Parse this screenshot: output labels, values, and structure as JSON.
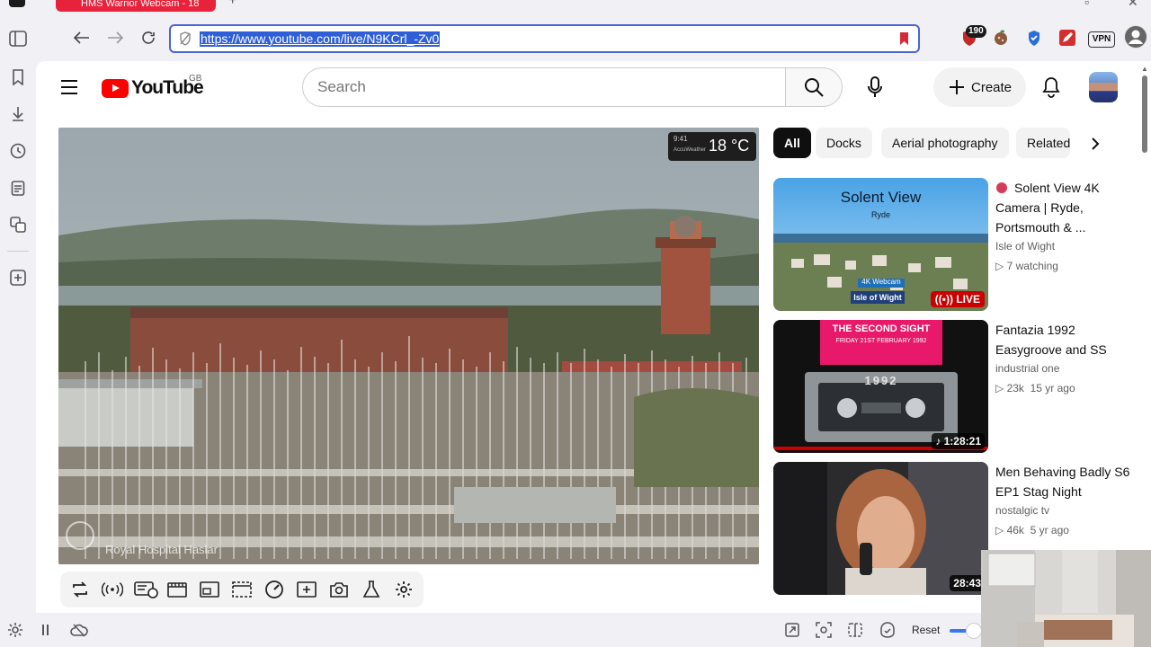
{
  "browser": {
    "tab_title": "HMS Warrior Webcam - 18",
    "url": "https://www.youtube.com/live/N9KCrl_-Zv0",
    "extension_badge": "190",
    "vpn_label": "VPN"
  },
  "youtube": {
    "logo_text": "YouTube",
    "region": "GB",
    "search_placeholder": "Search",
    "create_label": "Create"
  },
  "video": {
    "weather_time": "9:41",
    "weather_brand": "AccuWeather",
    "temperature": "18 °C",
    "camera_label": "Royal Hospital Haslar"
  },
  "chips": [
    "All",
    "Docks",
    "Aerial photography",
    "Related"
  ],
  "recommendations": [
    {
      "title": "Solent View 4K Camera | Ryde, Portsmouth & ...",
      "channel": "Isle of Wight",
      "meta": "7 watching",
      "badge": "LIVE",
      "thumb_title": "Solent View",
      "thumb_sub": "Ryde",
      "thumb_tag": "4K Webcam",
      "thumb_logo": "Isle of Wight"
    },
    {
      "title": "Fantazia 1992 Easygroove and SS",
      "channel": "industrial one",
      "views": "23k",
      "age": "15 yr ago",
      "duration": "1:28:21",
      "thumb_line1": "THE SECOND SIGHT",
      "thumb_line2": "FRIDAY 21ST FEBRUARY 1992",
      "thumb_tape": "1992"
    },
    {
      "title": "Men Behaving Badly S6 EP1  Stag Night",
      "channel": "nostalgic tv",
      "views": "46k",
      "age": "5 yr ago",
      "duration": "28:43"
    }
  ],
  "statusbar": {
    "reset_label": "Reset"
  },
  "colors": {
    "accent": "#4b64d6",
    "youtube_red": "#ff0000",
    "url_highlight": "#2f5fd8"
  }
}
